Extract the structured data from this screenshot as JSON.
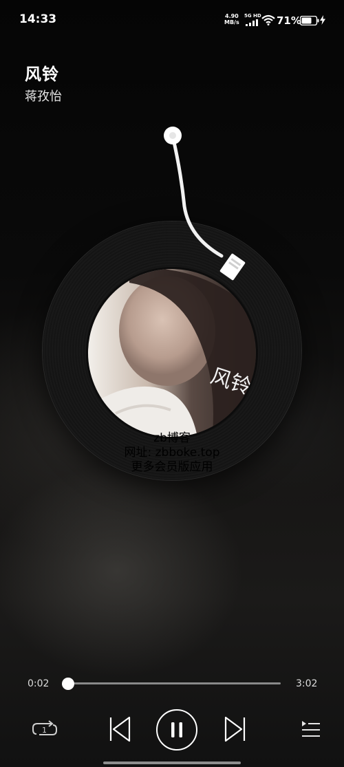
{
  "status_bar": {
    "time": "14:33",
    "net_speed_value": "4.90",
    "net_speed_unit": "MB/s",
    "net_type": "5G HD",
    "battery_percent": "71%",
    "icons": [
      "signal-icon",
      "wifi-icon",
      "battery-icon",
      "charging-icon"
    ]
  },
  "song": {
    "title": "风铃",
    "artist": "蒋孜怡"
  },
  "watermark": {
    "line1": "zb博客",
    "line2": "网址: zbboke.top",
    "line3": "更多会员版应用"
  },
  "progress": {
    "elapsed": "0:02",
    "total": "3:02",
    "fraction": 0.011
  },
  "controls": {
    "icons": [
      "repeat-one-icon",
      "previous-icon",
      "pause-icon",
      "next-icon",
      "playlist-icon"
    ]
  },
  "colors": {
    "accent": "#ffffff",
    "track": "#8a8a8a",
    "background": "#0a0a0a"
  }
}
